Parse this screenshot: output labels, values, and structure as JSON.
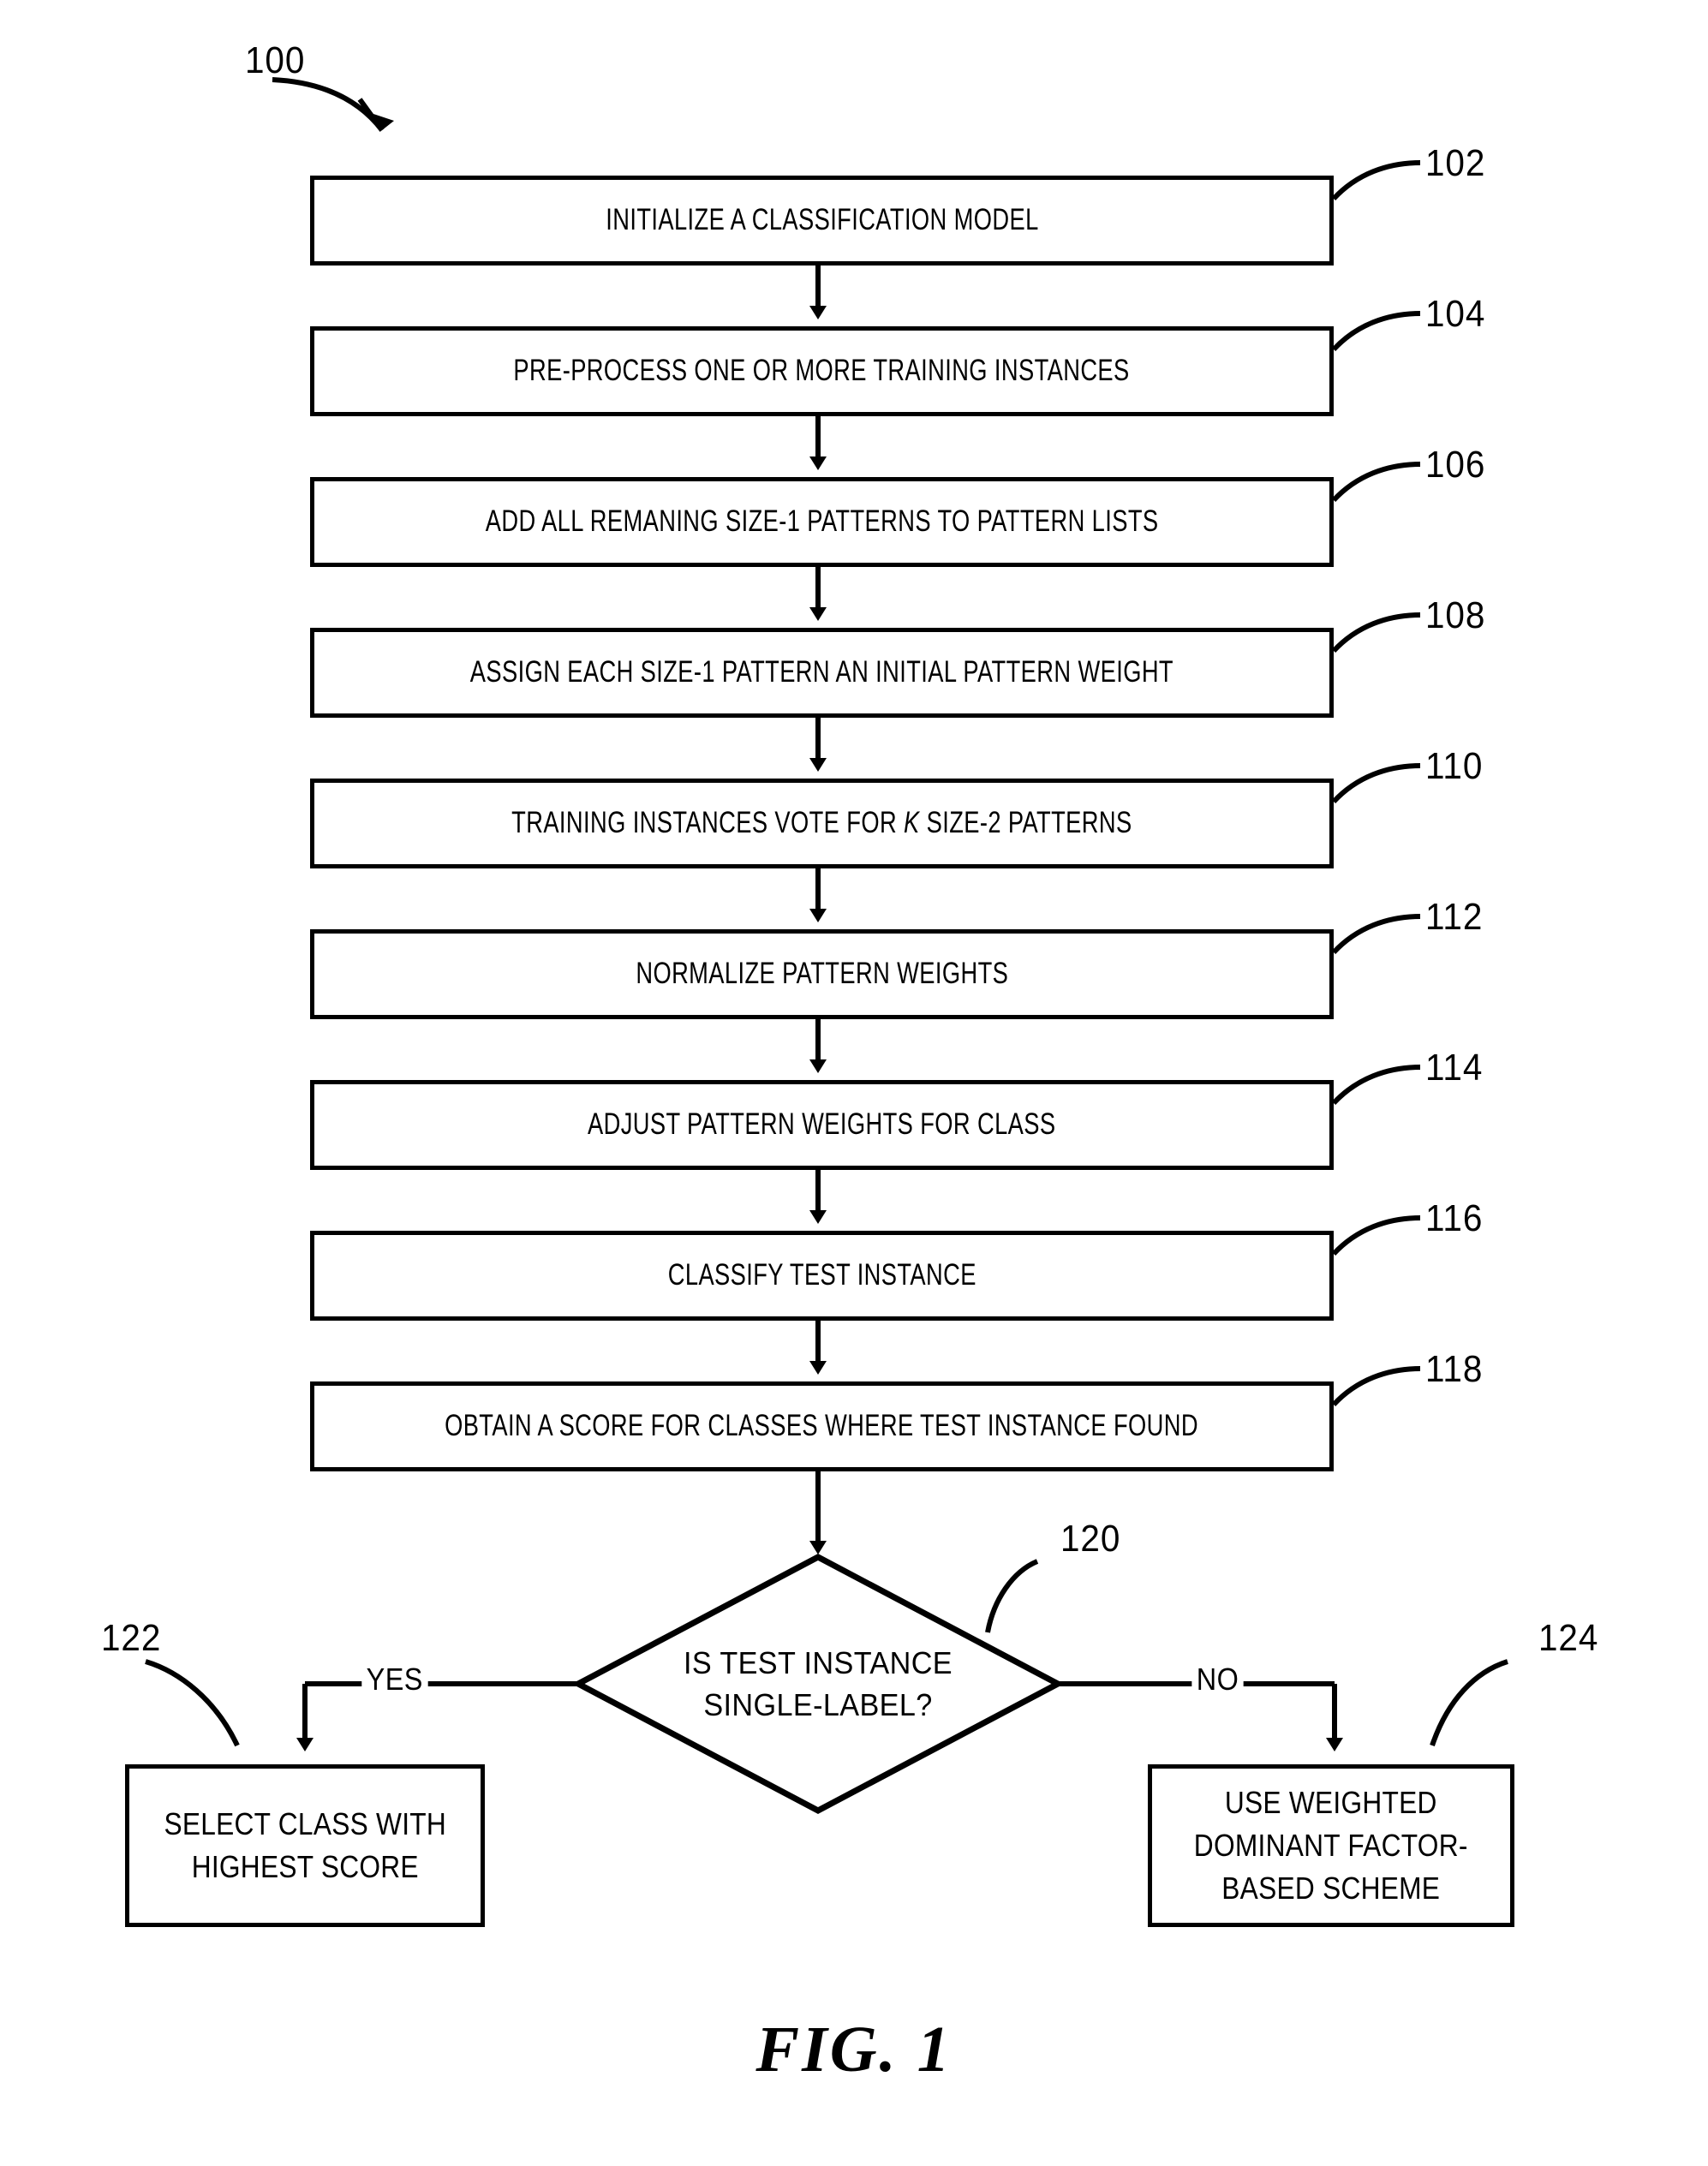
{
  "figure": {
    "caption": "FIG. 1",
    "diagram_ref": "100",
    "type": "patent-flowchart"
  },
  "steps": [
    {
      "ref": "102",
      "text": "INITIALIZE A CLASSIFICATION MODEL"
    },
    {
      "ref": "104",
      "text": "PRE-PROCESS ONE OR MORE TRAINING INSTANCES"
    },
    {
      "ref": "106",
      "text": "ADD ALL REMANING SIZE-1 PATTERNS TO PATTERN LISTS"
    },
    {
      "ref": "108",
      "text": "ASSIGN EACH SIZE-1 PATTERN AN INITIAL PATTERN WEIGHT"
    },
    {
      "ref": "110",
      "text": "TRAINING INSTANCES VOTE FOR K SIZE-2 PATTERNS",
      "italic_token": "K"
    },
    {
      "ref": "112",
      "text": "NORMALIZE PATTERN WEIGHTS"
    },
    {
      "ref": "114",
      "text": "ADJUST PATTERN WEIGHTS FOR CLASS"
    },
    {
      "ref": "116",
      "text": "CLASSIFY TEST INSTANCE"
    },
    {
      "ref": "118",
      "text": "OBTAIN A SCORE FOR CLASSES WHERE TEST INSTANCE FOUND"
    }
  ],
  "decision": {
    "ref": "120",
    "line1": "IS TEST INSTANCE",
    "line2": "SINGLE-LABEL?",
    "yes_label": "YES",
    "no_label": "NO"
  },
  "outcomes": [
    {
      "ref": "122",
      "line1": "SELECT CLASS WITH",
      "line2": "HIGHEST SCORE",
      "line3": ""
    },
    {
      "ref": "124",
      "line1": "USE WEIGHTED",
      "line2": "DOMINANT FACTOR-",
      "line3": "BASED SCHEME"
    }
  ],
  "style": {
    "ink": "#000000",
    "paper": "#ffffff"
  }
}
